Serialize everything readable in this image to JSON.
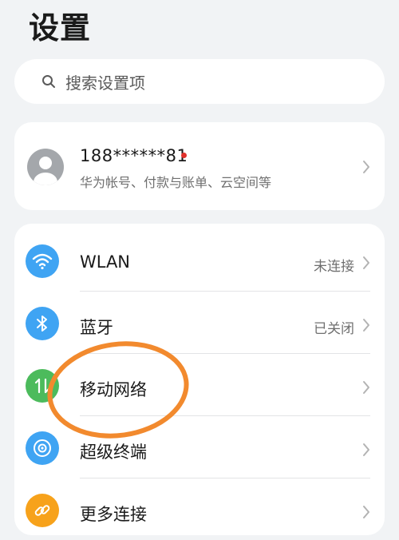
{
  "page": {
    "title": "设置"
  },
  "search": {
    "placeholder": "搜索设置项"
  },
  "account": {
    "name": "188******81",
    "subtitle": "华为帐号、付款与账单、云空间等"
  },
  "list": [
    {
      "label": "WLAN",
      "status": "未连接",
      "icon": "wifi-icon",
      "color": "#3fa4f3"
    },
    {
      "label": "蓝牙",
      "status": "已关闭",
      "icon": "bluetooth-icon",
      "color": "#3fa4f3"
    },
    {
      "label": "移动网络",
      "status": "",
      "icon": "mobile-data-icon",
      "color": "#4cbb5c"
    },
    {
      "label": "超级终端",
      "status": "",
      "icon": "super-device-icon",
      "color": "#3fa4f3"
    },
    {
      "label": "更多连接",
      "status": "",
      "icon": "link-icon",
      "color": "#f7a21b"
    }
  ],
  "colors": {
    "annotation": "#f28a2e",
    "background": "#f1f3f5"
  }
}
